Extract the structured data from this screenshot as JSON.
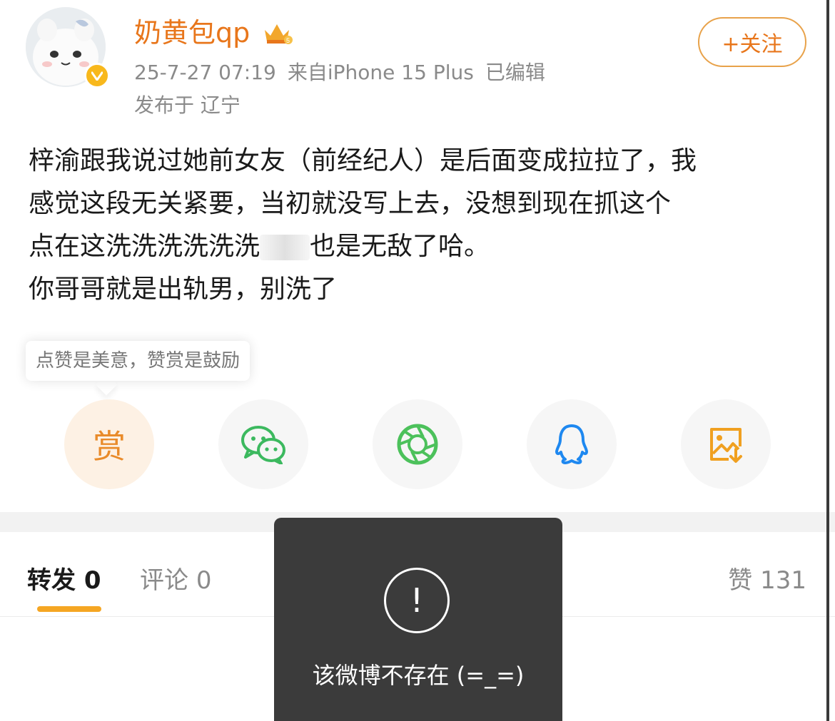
{
  "post": {
    "username": "奶黄包qp",
    "date": "25-7-27 07:19",
    "source": "来自iPhone 15 Plus",
    "edited": "已编辑",
    "location": "发布于 辽宁",
    "follow_label": "+关注",
    "text_line1": "梓渝跟我说过她前女友（前经纪人）是后面变成拉拉了，我",
    "text_line2": "感觉这段无关紧要，当初就没写上去，没想到现在抓这个",
    "text_line3a": "点在这洗洗洗洗洗洗",
    "text_line3b": "也是无敌了哈。",
    "text_line4": "你哥哥就是出轨男，别洗了"
  },
  "reward": {
    "tip": "点赞是美意，赞赏是鼓励",
    "button_label": "赏"
  },
  "share": {
    "icons": [
      "wechat-icon",
      "moments-icon",
      "qq-icon",
      "save-image-icon"
    ],
    "colors": {
      "wechat": "#3cb95f",
      "moments": "#4cc15b",
      "qq": "#1e88f0",
      "save": "#f0a020",
      "accent": "#e8761b"
    }
  },
  "tabs": {
    "repost_label": "转发",
    "repost_count": "0",
    "comment_label": "评论",
    "comment_count": "0",
    "like_label": "赞",
    "like_count": "131"
  },
  "toast": {
    "icon": "exclamation-icon",
    "message": "该微博不存在 (=_=)"
  }
}
